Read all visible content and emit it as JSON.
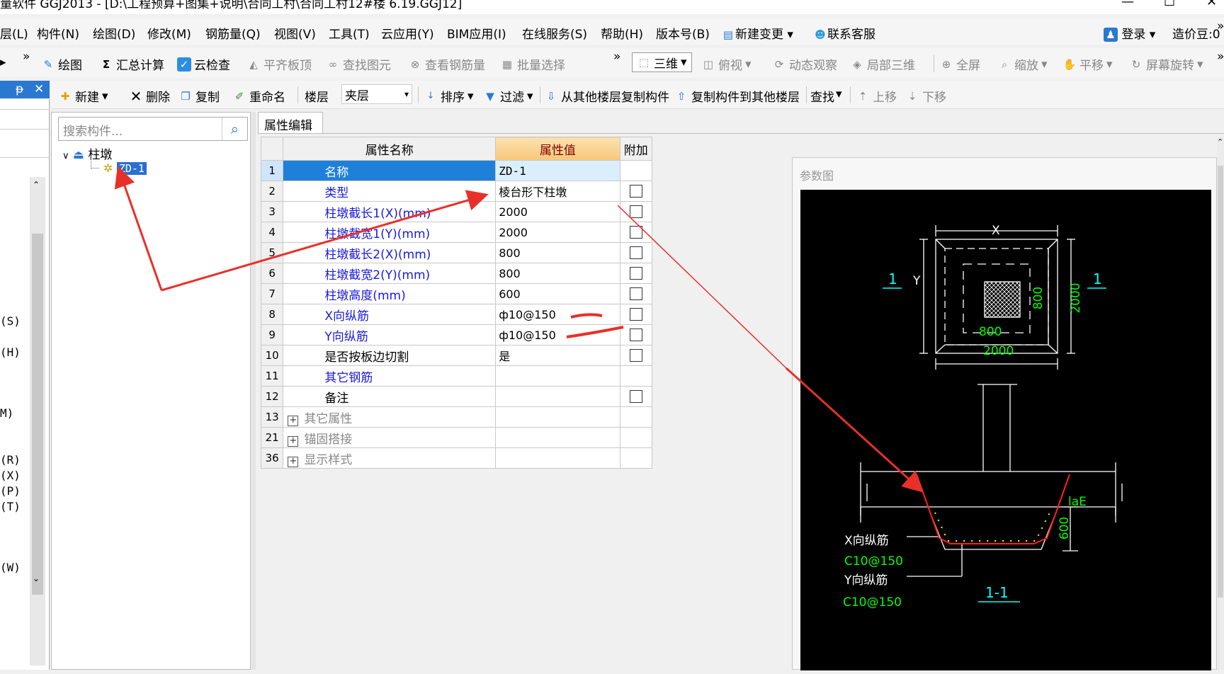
{
  "window": {
    "title": "量软件 GGJ2013 - [D:\\工程预算+图集+说明\\合同工村\\合同工村12#楼 6.19.GGJ12]",
    "minimize": "—",
    "maximize": "☐",
    "close": "✕"
  },
  "menu": {
    "items": [
      "层(L)",
      "构件(N)",
      "绘图(D)",
      "修改(M)",
      "钢筋量(Q)",
      "视图(V)",
      "工具(T)",
      "云应用(Y)",
      "BIM应用(I)",
      "在线服务(S)",
      "帮助(H)",
      "版本号(B)",
      "新建变更",
      "联系客服"
    ],
    "login": "登录",
    "price_bean": "造价豆:0",
    "overflow": "»"
  },
  "toolbar1": {
    "items": [
      "绘图",
      "汇总计算",
      "云检查",
      "平齐板顶",
      "查找图元",
      "查看钢筋量",
      "批量选择"
    ],
    "view_items": [
      "三维",
      "俯视",
      "动态观察",
      "局部三维",
      "全屏",
      "缩放",
      "平移",
      "屏幕旋转"
    ],
    "overflow": "»"
  },
  "toolbar2": {
    "new": "新建",
    "delete": "删除",
    "copy": "复制",
    "rename": "重命名",
    "floor_label": "楼层",
    "floor_value": "夹层",
    "sort": "排序",
    "filter": "过滤",
    "copy_from_other": "从其他楼层复制构件",
    "copy_to_other": "复制构件到其他楼层",
    "find": "查找",
    "move_up": "上移",
    "move_down": "下移"
  },
  "left_panel": {
    "pin": "ᵽ",
    "close": "✕",
    "cut_labels": [
      "(S)",
      "(H)",
      "M)",
      "(R)",
      "(X)",
      "(P)",
      "(T)",
      "(W)"
    ]
  },
  "component_tree": {
    "search_placeholder": "搜索构件...",
    "root": "柱墩",
    "child": "ZD-1"
  },
  "property_editor": {
    "tab": "属性编辑",
    "headers": [
      "属性名称",
      "属性值",
      "附加"
    ],
    "rows": [
      {
        "num": "1",
        "name": "名称",
        "value": "ZD-1",
        "check": false,
        "color": "blue"
      },
      {
        "num": "2",
        "name": "类型",
        "value": "棱台形下柱墩",
        "check": true,
        "color": "blue"
      },
      {
        "num": "3",
        "name": "柱墩截长1(X)(mm)",
        "value": "2000",
        "check": true,
        "color": "blue"
      },
      {
        "num": "4",
        "name": "柱墩截宽1(Y)(mm)",
        "value": "2000",
        "check": true,
        "color": "blue"
      },
      {
        "num": "5",
        "name": "柱墩截长2(X)(mm)",
        "value": "800",
        "check": true,
        "color": "blue"
      },
      {
        "num": "6",
        "name": "柱墩截宽2(Y)(mm)",
        "value": "800",
        "check": true,
        "color": "blue"
      },
      {
        "num": "7",
        "name": "柱墩高度(mm)",
        "value": "600",
        "check": true,
        "color": "blue"
      },
      {
        "num": "8",
        "name": "X向纵筋",
        "value": "ф10@150",
        "check": true,
        "color": "blue"
      },
      {
        "num": "9",
        "name": "Y向纵筋",
        "value": "ф10@150",
        "check": true,
        "color": "blue"
      },
      {
        "num": "10",
        "name": "是否按板边切割",
        "value": "是",
        "check": true,
        "color": "black"
      },
      {
        "num": "11",
        "name": "其它钢筋",
        "value": "",
        "check": false,
        "color": "blue"
      },
      {
        "num": "12",
        "name": "备注",
        "value": "",
        "check": true,
        "color": "black"
      },
      {
        "num": "13",
        "name": "其它属性",
        "value": "",
        "check": false,
        "color": "gray",
        "expand": true
      },
      {
        "num": "21",
        "name": "锚固搭接",
        "value": "",
        "check": false,
        "color": "gray",
        "expand": true
      },
      {
        "num": "36",
        "name": "显示样式",
        "value": "",
        "check": false,
        "color": "gray",
        "expand": true
      }
    ]
  },
  "param_diagram": {
    "title": "参数图",
    "labels": {
      "x": "X",
      "y": "Y",
      "section_left": "1",
      "section_right": "1",
      "dim_800_v": "800",
      "dim_2000_v": "2000",
      "dim_800_h": "800",
      "dim_2000_h": "2000",
      "lae": "laE",
      "dim_600": "600",
      "x_rebar": "X向纵筋",
      "x_rebar_val": "C10@150",
      "y_rebar": "Y向纵筋",
      "y_rebar_val": "C10@150",
      "section_name": "1-1"
    },
    "colors": {
      "cyan": "#00ffff",
      "green": "#00ff00",
      "white": "#ffffff",
      "red": "#ff2020",
      "yellow": "#ffff00"
    }
  },
  "annotation_color": "#e8302a"
}
